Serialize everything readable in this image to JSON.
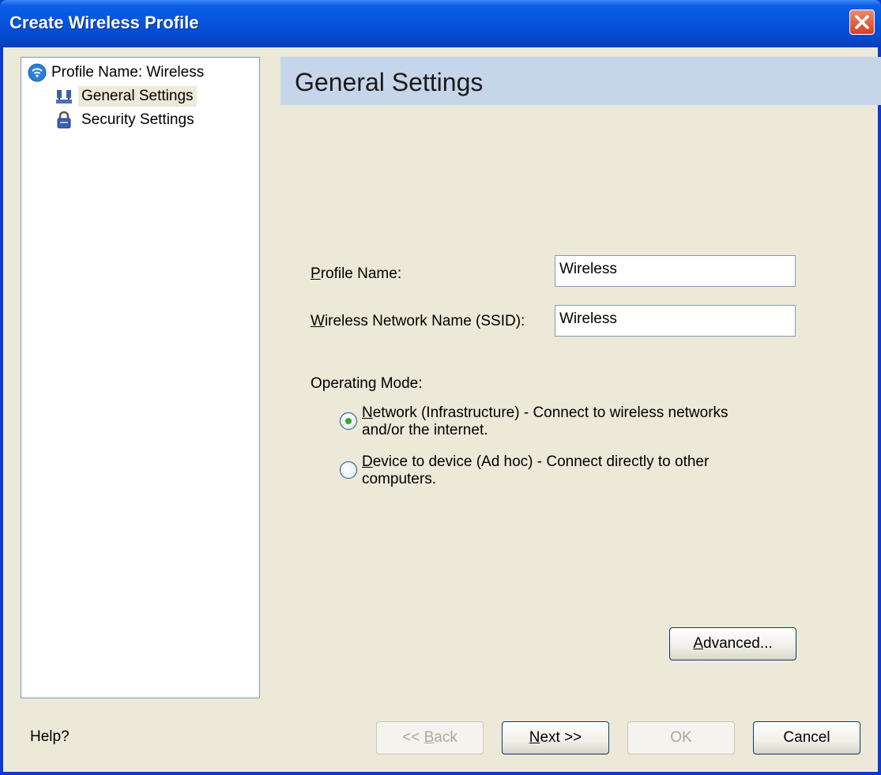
{
  "window": {
    "title": "Create Wireless Profile"
  },
  "tree": {
    "root_label": "Profile Name: Wireless",
    "items": [
      {
        "label": "General Settings",
        "selected": true,
        "icon": "network-icon"
      },
      {
        "label": "Security Settings",
        "selected": false,
        "icon": "lock-icon"
      }
    ]
  },
  "header": {
    "title": "General Settings"
  },
  "form": {
    "profile_name": {
      "label_accel": "P",
      "label_rest": "rofile Name:",
      "value": "Wireless"
    },
    "ssid": {
      "label_accel": "W",
      "label_rest": "ireless Network Name (SSID):",
      "value": "Wireless"
    },
    "operating_mode_label": "Operating Mode:",
    "modes": [
      {
        "accel": "N",
        "line1_rest": "etwork (Infrastructure) - Connect to wireless networks",
        "line2": "and/or the internet.",
        "selected": true
      },
      {
        "accel": "D",
        "line1_rest": "evice to device (Ad hoc) - Connect directly to other",
        "line2": "computers.",
        "selected": false
      }
    ]
  },
  "buttons": {
    "advanced_accel": "A",
    "advanced_rest": "dvanced...",
    "back_pre": "<< ",
    "back_accel": "B",
    "back_rest": "ack",
    "next_accel": "N",
    "next_rest": "ext >>",
    "ok": "OK",
    "cancel": "Cancel"
  },
  "help": "Help?",
  "colors": {
    "titlebar": "#0553db",
    "header_band": "#c6d6ea",
    "dialog_bg": "#ece9d8",
    "radio_dot": "#31a831"
  }
}
